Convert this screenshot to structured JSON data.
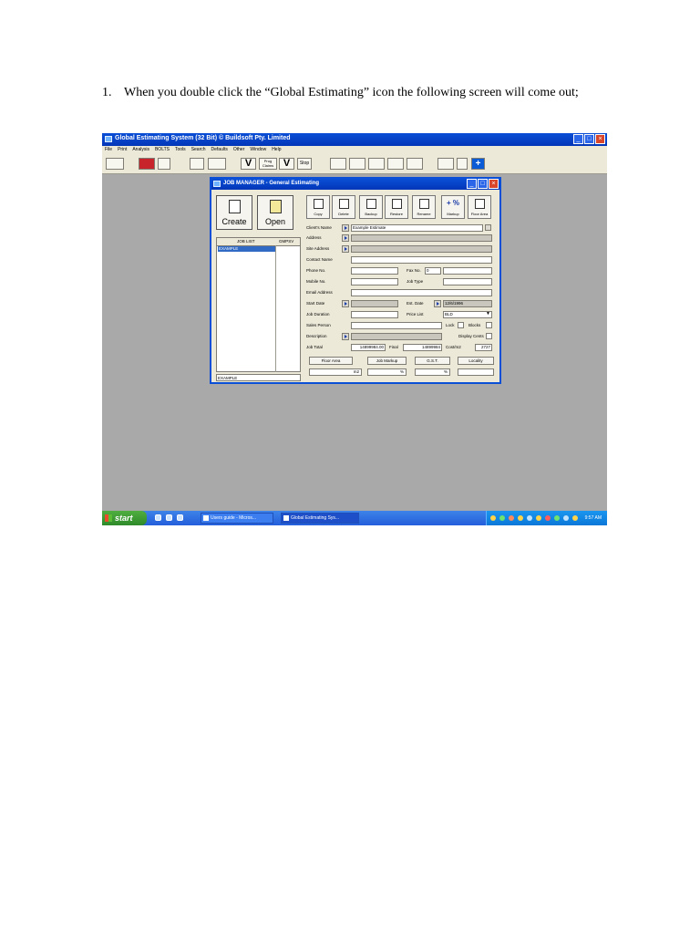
{
  "doc": {
    "item_number": "1.",
    "item_text": "When you double click the “Global Estimating” icon the following screen will come out;"
  },
  "app": {
    "title": "Global Estimating System (32 Bit) © Buildsoft Pty. Limited",
    "menu": [
      "File",
      "Print",
      "Analysis",
      "BOLTS",
      "Tools",
      "Search",
      "Defaults",
      "Other",
      "Window",
      "Help"
    ],
    "toolbar": {
      "v1": "V",
      "prog_claims": "Prog Claims",
      "v2": "V",
      "stop": "Stop"
    }
  },
  "dialog": {
    "title": "JOB MANAGER - General Estimating",
    "create_label": "Create",
    "open_label": "Open",
    "toolbar": [
      "Copy",
      "Delete",
      "Backup",
      "Restore",
      "Rename",
      "Markup",
      "Floor Area"
    ],
    "markup_glyph": "+ %",
    "list_col1": "JOB LIST",
    "list_col2": "GMPSV",
    "selected_job": "EXAMPLE",
    "footer_job": "EXAMPLE",
    "fields": {
      "clients_name_label": "Client's Name",
      "clients_name_value": "Example Estimate",
      "address_label": "Address",
      "site_address_label": "Site Address",
      "contact_name_label": "Contact Name",
      "phone_label": "Phone No.",
      "fax_label": "Fax No.",
      "fax_value": "0",
      "mobile_label": "Mobile No.",
      "job_type_label": "Job Type",
      "email_label": "Email Address",
      "start_date_label": "Start Date",
      "est_date_label": "Est. Date",
      "est_date_value": "12/6/1996",
      "job_duration_label": "Job Duration",
      "price_list_label": "Price List",
      "price_list_value": "BLD",
      "sales_person_label": "Sales Person",
      "lock_label": "Lock",
      "blocks_label": "Blocks",
      "description_label": "Description",
      "display_cents_label": "Display Cents",
      "job_total_label": "Job Total",
      "job_total_value": "14899984.00",
      "final_label": "Final",
      "final_value": "14899984",
      "cost_m2_label": "Cost/m2",
      "cost_m2_value": "2727"
    },
    "tabs": [
      "Floor Area",
      "Job Markup",
      "G.S.T.",
      "Locality"
    ],
    "units": {
      "m2": "m2",
      "pct1": "%",
      "pct2": "%"
    }
  },
  "taskbar": {
    "start": "start",
    "tasks": [
      "Users guide - Micros...",
      "Global Estimating Sys..."
    ],
    "clock": "9:57 AM"
  },
  "colors": {
    "xp_blue": "#0a4fd6",
    "desktop": "#a9a9a9",
    "start_green": "#3a9b31"
  }
}
